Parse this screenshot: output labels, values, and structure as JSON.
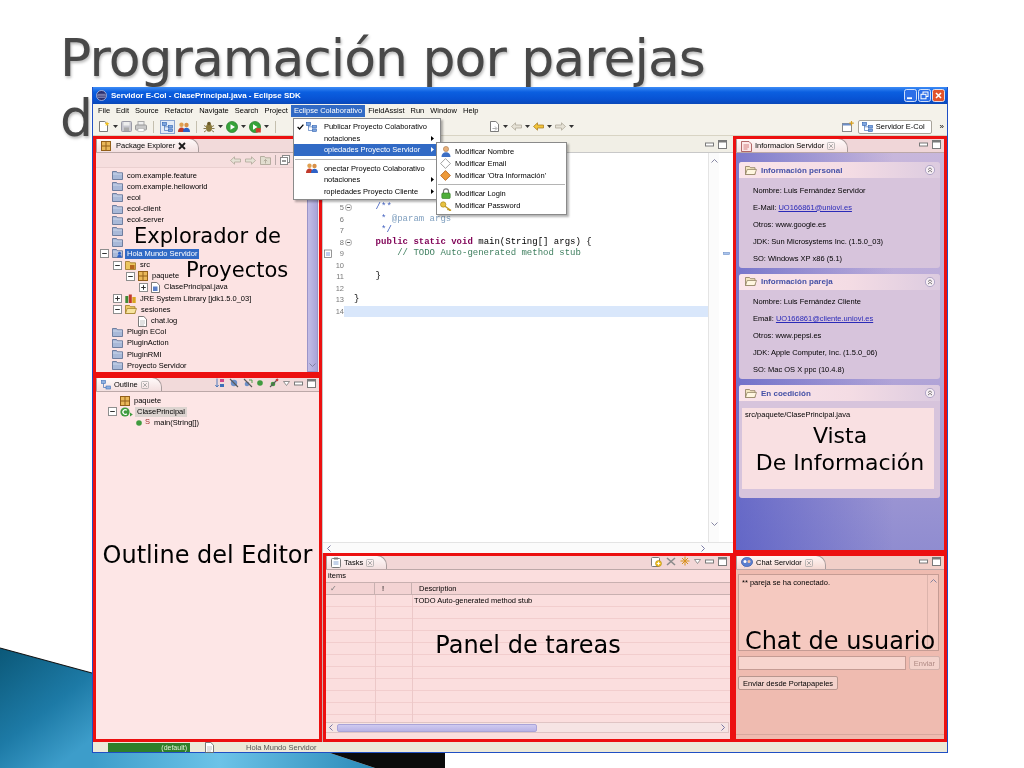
{
  "slide": {
    "title_lines": [
      "Programación por parejas",
      "d"
    ]
  },
  "window": {
    "title": "Servidor E-Col - ClasePrincipal.java - Eclipse SDK"
  },
  "menu_bar": [
    {
      "label": "File",
      "selected": false
    },
    {
      "label": "Edit",
      "selected": false
    },
    {
      "label": "Source",
      "selected": false
    },
    {
      "label": "Refactor",
      "selected": false
    },
    {
      "label": "Navigate",
      "selected": false
    },
    {
      "label": "Search",
      "selected": false
    },
    {
      "label": "Project",
      "selected": false
    },
    {
      "label": "Eclipse Colaborativo",
      "selected": true
    },
    {
      "label": "FieldAssist",
      "selected": false
    },
    {
      "label": "Run",
      "selected": false
    },
    {
      "label": "Window",
      "selected": false
    },
    {
      "label": "Help",
      "selected": false
    }
  ],
  "menu": [
    {
      "kind": "item",
      "label": "Publicar Proyecto Colaborativo",
      "checked": true,
      "selected": false
    },
    {
      "kind": "submenu",
      "label": "notaciones",
      "selected": false
    },
    {
      "kind": "submenu",
      "label": "opiedades Proyecto Servidor",
      "selected": true
    },
    {
      "kind": "separator"
    },
    {
      "kind": "item",
      "label": "onectar Proyecto Colaborativo",
      "checked": false,
      "selected": false
    },
    {
      "kind": "submenu",
      "label": "notaciones",
      "selected": false
    },
    {
      "kind": "submenu",
      "label": "ropiedades Proyecto Cliente",
      "selected": false
    }
  ],
  "submenu": [
    {
      "kind": "item",
      "label": "Modificar Nombre"
    },
    {
      "kind": "item",
      "label": "Modificar Email"
    },
    {
      "kind": "item",
      "label": "Modificar 'Otra Información'"
    },
    {
      "kind": "separator"
    },
    {
      "kind": "item",
      "label": "Modificar Login"
    },
    {
      "kind": "item",
      "label": "Modificar Password"
    }
  ],
  "toolbar": {
    "perspective": {
      "label": "Servidor E-Col",
      "selected": true
    },
    "overflow": "»"
  },
  "package_explorer": {
    "tab": "Package Explorer",
    "annotation": [
      "Explorador de",
      "Proyectos"
    ],
    "tree": [
      {
        "kind": "project",
        "label": "com.example.feature",
        "selected": false
      },
      {
        "kind": "project",
        "label": "com.example.helloworld",
        "selected": false
      },
      {
        "kind": "project",
        "label": "ecol",
        "selected": false
      },
      {
        "kind": "project",
        "label": "ecol-client",
        "selected": false
      },
      {
        "kind": "project",
        "label": "ecol-server",
        "selected": false
      },
      {
        "kind": "project"
      },
      {
        "kind": "project"
      },
      {
        "kind": "shared-project",
        "label": "Hola Mundo Servidor",
        "selected": true,
        "expanded": true,
        "children": [
          {
            "kind": "source-folder",
            "label": "src",
            "selected": false,
            "expanded": true,
            "children": [
              {
                "kind": "package",
                "label": "paquete",
                "selected": false,
                "expanded": true,
                "children": [
                  {
                    "kind": "java-file",
                    "label": "ClasePrincipal.java",
                    "selected": false,
                    "expanded": false
                  }
                ]
              }
            ]
          },
          {
            "kind": "library",
            "label": "JRE System Library [jdk1.5.0_03]",
            "selected": false,
            "expanded": false
          },
          {
            "kind": "folder",
            "label": "sesiones",
            "selected": false,
            "expanded": true,
            "children": [
              {
                "kind": "file",
                "label": "chat.log",
                "selected": false
              }
            ]
          }
        ]
      },
      {
        "kind": "project",
        "label": "Plugin ECol",
        "selected": false
      },
      {
        "kind": "project",
        "label": "PluginAction",
        "selected": false
      },
      {
        "kind": "project",
        "label": "PluginRMI",
        "selected": false
      },
      {
        "kind": "project",
        "label": "Proyecto Servidor",
        "selected": false
      }
    ]
  },
  "outline": {
    "tab": "Outline",
    "annotation": [
      "Outline del Editor"
    ],
    "tree": [
      {
        "kind": "package",
        "label": "paquete",
        "selected": false
      },
      {
        "kind": "class",
        "label": "ClasePrincipal",
        "selected": true,
        "expanded": true,
        "children": [
          {
            "kind": "method",
            "label": "main(String[])",
            "modifier": "S",
            "selected": false
          }
        ]
      }
    ]
  },
  "editor": {
    "lines": [
      {
        "number": "5",
        "fold": true,
        "marker": false,
        "current": false,
        "tokens": [
          {
            "kind": "javadoc",
            "text": "    /**"
          }
        ]
      },
      {
        "number": "6",
        "fold": false,
        "marker": false,
        "current": false,
        "tokens": [
          {
            "kind": "javadoc",
            "text": "     * "
          },
          {
            "kind": "javadoc-tag",
            "text": "@param args"
          }
        ]
      },
      {
        "number": "7",
        "fold": false,
        "marker": false,
        "current": false,
        "tokens": [
          {
            "kind": "javadoc",
            "text": "     */"
          }
        ]
      },
      {
        "number": "8",
        "fold": true,
        "marker": false,
        "current": false,
        "tokens": [
          {
            "kind": "keyword",
            "text": "    public static void"
          },
          {
            "kind": "plain",
            "text": " main(String[] args) {"
          }
        ]
      },
      {
        "number": "9",
        "fold": false,
        "marker": true,
        "current": false,
        "tokens": [
          {
            "kind": "comment",
            "text": "        // TODO Auto-generated method stub"
          }
        ]
      },
      {
        "number": "10",
        "fold": false,
        "marker": false,
        "current": false
      },
      {
        "number": "11",
        "fold": false,
        "marker": false,
        "current": false,
        "tokens": [
          {
            "kind": "plain",
            "text": "    }"
          }
        ]
      },
      {
        "number": "12",
        "fold": false,
        "marker": false,
        "current": false
      },
      {
        "number": "13",
        "fold": false,
        "marker": false,
        "current": false,
        "tokens": [
          {
            "kind": "plain",
            "text": "}"
          }
        ]
      },
      {
        "number": "14",
        "fold": false,
        "marker": false,
        "current": true
      }
    ]
  },
  "tasks": {
    "tab": "Tasks",
    "annotation": [
      "Panel de tareas"
    ],
    "summary": "items",
    "columns": [
      "✓",
      "!",
      "Description"
    ],
    "rows": [
      {
        "description": "TODO Auto-generated method stub"
      }
    ]
  },
  "info_view": {
    "tab": "Informacion Servidor",
    "annotation": [
      "Vista",
      "De Información"
    ],
    "sections": [
      {
        "kind": "details",
        "title": "Información personal",
        "expanded": true,
        "lines": [
          {
            "text": "Nombre: Luis Fernández Servidor"
          },
          {
            "text": "E-Mail:",
            "link": "UO166861@uniovi.es"
          },
          {
            "text": "Otros: www.google.es"
          },
          {
            "text": "JDK: Sun Microsystems Inc. (1.5.0_03)"
          },
          {
            "text": "SO: Windows XP x86 (5.1)"
          }
        ]
      },
      {
        "kind": "details",
        "title": "Información pareja",
        "expanded": true,
        "lines": [
          {
            "text": "Nombre: Luis Fernández Cliente"
          },
          {
            "text": "Email:",
            "link": "UO166861@cliente.uniovi.es"
          },
          {
            "text": "Otros: www.pepsi.es"
          },
          {
            "text": "JDK: Apple Computer, Inc. (1.5.0_06)"
          },
          {
            "text": "SO: Mac OS X ppc (10.4.8)"
          }
        ]
      },
      {
        "kind": "files",
        "title": "En coedición",
        "expanded": true,
        "files": [
          "src/paquete/ClasePrincipal.java"
        ]
      }
    ]
  },
  "chat": {
    "tab": "Chat Servidor",
    "annotation": [
      "Chat de usuario"
    ],
    "messages": [
      "** pareja se ha conectado."
    ],
    "send_button": {
      "label": "Enviar",
      "disabled": true
    },
    "clipboard_button": {
      "label": "Enviar desde Portapapeles",
      "disabled": false
    }
  },
  "status_bar": {
    "items": [
      {
        "kind": "indicator",
        "text": "(default)"
      },
      {
        "kind": "text",
        "text": "Hola Mundo Servidor"
      }
    ]
  }
}
